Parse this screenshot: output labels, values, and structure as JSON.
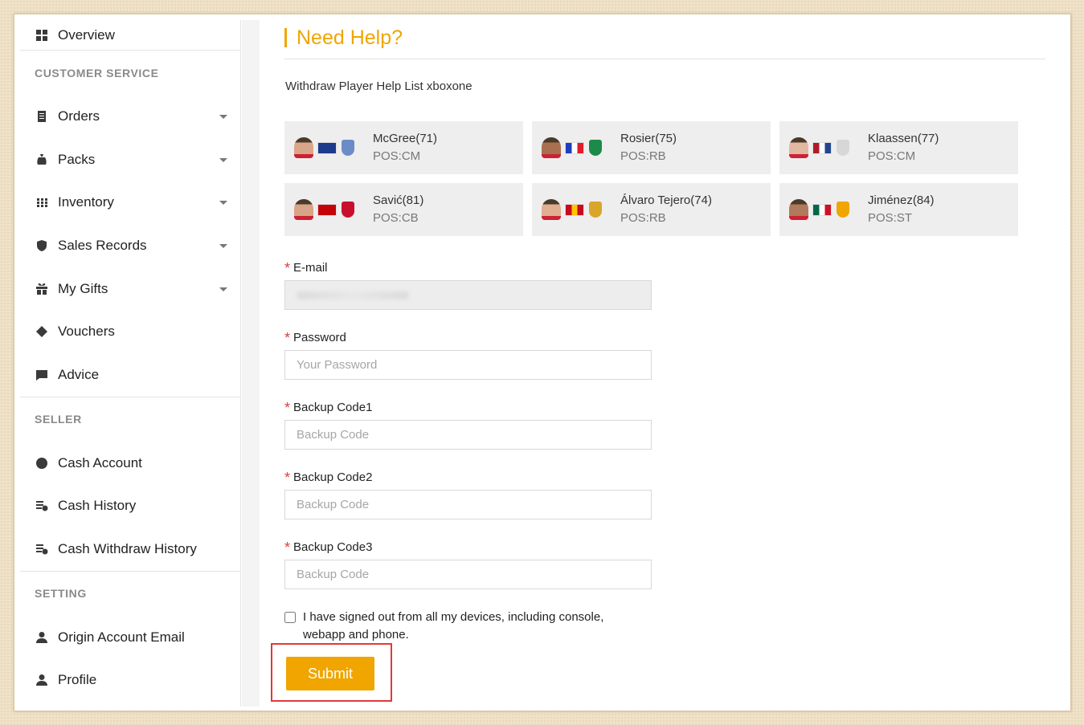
{
  "sidebar": {
    "overview": "Overview",
    "sections": [
      {
        "title": "CUSTOMER SERVICE",
        "items": [
          {
            "label": "Orders",
            "icon": "orders-icon",
            "dropdown": true
          },
          {
            "label": "Packs",
            "icon": "packs-bag-icon",
            "dropdown": true
          },
          {
            "label": "Inventory",
            "icon": "grid-dots-icon",
            "dropdown": true
          },
          {
            "label": "Sales Records",
            "icon": "shield-dollar-icon",
            "dropdown": true
          },
          {
            "label": "My Gifts",
            "icon": "gift-icon",
            "dropdown": true
          },
          {
            "label": "Vouchers",
            "icon": "ticket-icon",
            "dropdown": false
          },
          {
            "label": "Advice",
            "icon": "message-icon",
            "dropdown": false
          }
        ]
      },
      {
        "title": "SELLER",
        "items": [
          {
            "label": "Cash Account",
            "icon": "dollar-circle-icon",
            "dropdown": false
          },
          {
            "label": "Cash History",
            "icon": "cash-history-icon",
            "dropdown": false
          },
          {
            "label": "Cash Withdraw History",
            "icon": "cash-withdraw-icon",
            "dropdown": false
          }
        ]
      },
      {
        "title": "SETTING",
        "items": [
          {
            "label": "Origin Account Email",
            "icon": "user-icon",
            "dropdown": false
          },
          {
            "label": "Profile",
            "icon": "user-icon",
            "dropdown": false
          }
        ]
      }
    ]
  },
  "main": {
    "title": "Need Help?",
    "subtitle": "Withdraw Player Help List xboxone",
    "players": [
      {
        "name": "McGree(71)",
        "pos": "POS:CM",
        "skin": "#d9a68a",
        "flag": [
          "#1e3a8a",
          "#1e3a8a",
          "#1e3a8a"
        ],
        "badge": "#6b8cc7"
      },
      {
        "name": "Rosier(75)",
        "pos": "POS:RB",
        "skin": "#a9704f",
        "flag": [
          "#1d3fbf",
          "#ffffff",
          "#e11d2a"
        ],
        "badge": "#1c8a4a"
      },
      {
        "name": "Klaassen(77)",
        "pos": "POS:CM",
        "skin": "#e2b8a0",
        "flag": [
          "#ae1c28",
          "#ffffff",
          "#21468b"
        ],
        "badge": "#d7d7d7"
      },
      {
        "name": "Savić(81)",
        "pos": "POS:CB",
        "skin": "#d7a487",
        "flag": [
          "#c40308",
          "#c40308",
          "#c40308"
        ],
        "badge": "#c8102e"
      },
      {
        "name": "Álvaro Tejero(74)",
        "pos": "POS:RB",
        "skin": "#e0ae90",
        "flag": [
          "#c60b1e",
          "#ffc400",
          "#c60b1e"
        ],
        "badge": "#d9a62b"
      },
      {
        "name": "Jiménez(84)",
        "pos": "POS:ST",
        "skin": "#b07a5c",
        "flag": [
          "#006847",
          "#ffffff",
          "#ce1126"
        ],
        "badge": "#f0a500"
      }
    ]
  },
  "form": {
    "email": {
      "label": "E-mail"
    },
    "password": {
      "label": "Password",
      "placeholder": "Your Password"
    },
    "backup1": {
      "label": "Backup Code1",
      "placeholder": "Backup Code"
    },
    "backup2": {
      "label": "Backup Code2",
      "placeholder": "Backup Code"
    },
    "backup3": {
      "label": "Backup Code3",
      "placeholder": "Backup Code"
    },
    "checkbox_text": "I have signed out from all my devices, including console, webapp and phone.",
    "submit_label": "Submit"
  },
  "colors": {
    "accent": "#f0a500",
    "required": "#e23b3b",
    "highlight_border": "#e03a3a"
  }
}
